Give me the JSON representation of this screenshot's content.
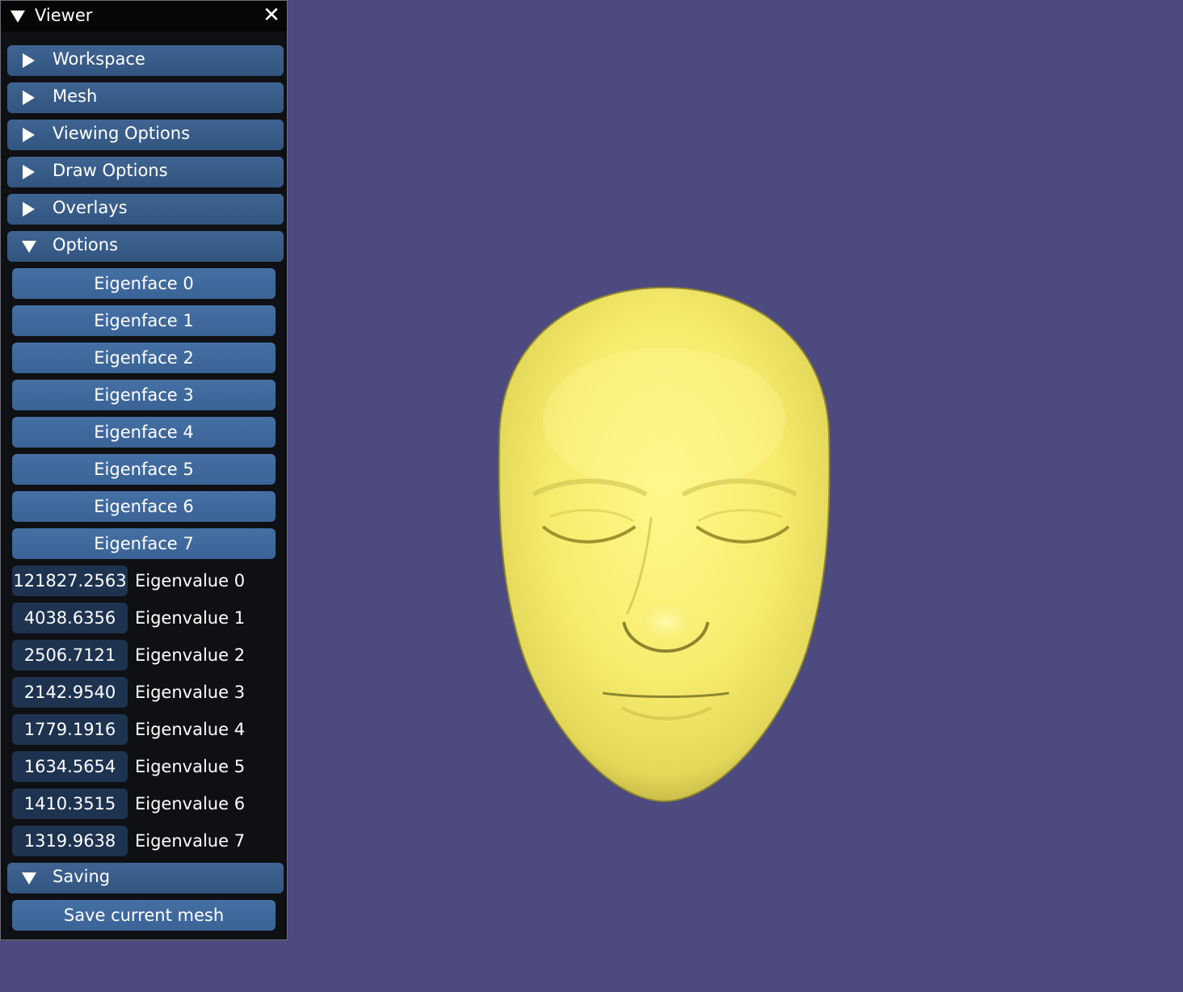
{
  "window": {
    "title": "Viewer",
    "close_glyph": "✕"
  },
  "sections": [
    {
      "label": "Workspace",
      "expanded": false
    },
    {
      "label": "Mesh",
      "expanded": false
    },
    {
      "label": "Viewing Options",
      "expanded": false
    },
    {
      "label": "Draw Options",
      "expanded": false
    },
    {
      "label": "Overlays",
      "expanded": false
    },
    {
      "label": "Options",
      "expanded": true
    }
  ],
  "eigenfaces": [
    "Eigenface 0",
    "Eigenface 1",
    "Eigenface 2",
    "Eigenface 3",
    "Eigenface 4",
    "Eigenface 5",
    "Eigenface 6",
    "Eigenface 7"
  ],
  "eigenvalues": [
    {
      "value": "121827.2563",
      "label": "Eigenvalue 0"
    },
    {
      "value": "4038.6356",
      "label": "Eigenvalue 1"
    },
    {
      "value": "2506.7121",
      "label": "Eigenvalue 2"
    },
    {
      "value": "2142.9540",
      "label": "Eigenvalue 3"
    },
    {
      "value": "1779.1916",
      "label": "Eigenvalue 4"
    },
    {
      "value": "1634.5654",
      "label": "Eigenvalue 5"
    },
    {
      "value": "1410.3515",
      "label": "Eigenvalue 6"
    },
    {
      "value": "1319.9638",
      "label": "Eigenvalue 7"
    }
  ],
  "saving": {
    "header": "Saving",
    "expanded": true,
    "save_button": "Save current mesh"
  },
  "colors": {
    "background": "#4c4a7e",
    "mesh": "#f6ec6e",
    "panel": "#0f1014",
    "header": "#3a5d8a",
    "button": "#4069a0",
    "value_box": "#1d3350"
  },
  "icons": {
    "collapse": "triangle-down-icon",
    "expand": "triangle-right-icon",
    "close": "close-icon"
  }
}
